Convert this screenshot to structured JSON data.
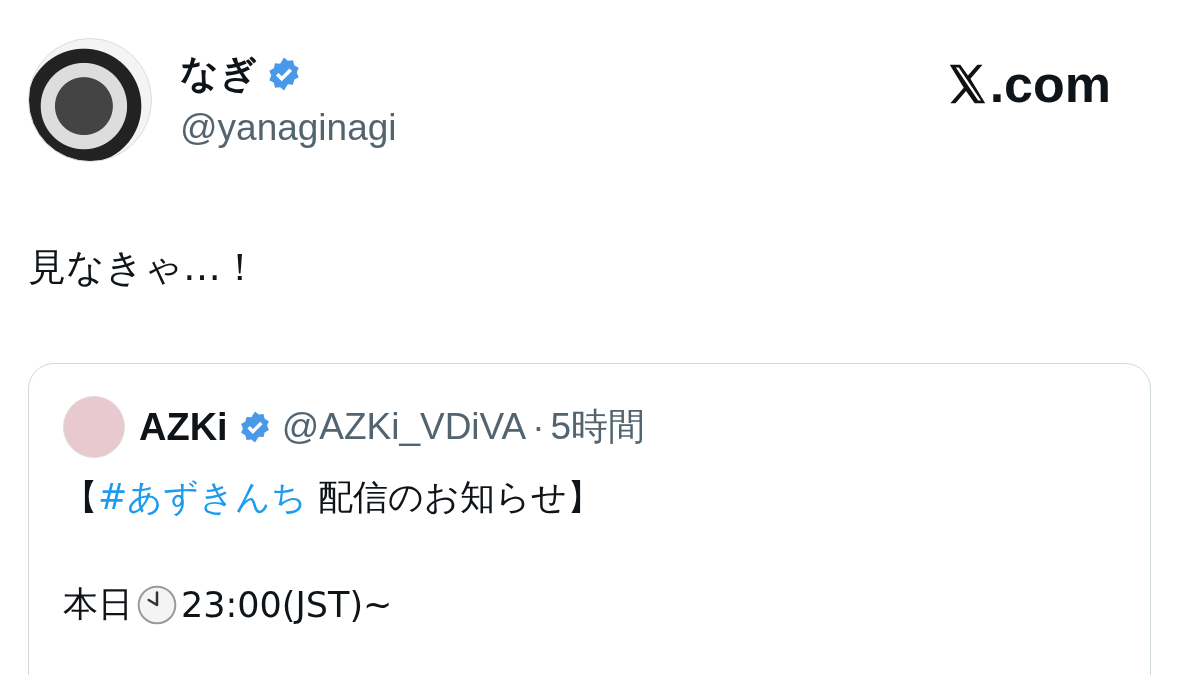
{
  "author": {
    "name": "なぎ",
    "verified": true,
    "handle": "@yanaginagi"
  },
  "site": {
    "domain": ".com"
  },
  "tweet": {
    "text": "見なきゃ…！"
  },
  "quote": {
    "author": {
      "name": "AZKi",
      "verified": true,
      "handle": "@AZKi_VDiVA",
      "separator": "·",
      "time": "5時間"
    },
    "lines": [
      {
        "kind": "title",
        "prefix": "【",
        "hashtag": "#あずきんち",
        "rest": " 配信のお知らせ】"
      },
      {
        "kind": "time",
        "before": "本日",
        "after": "23:00(JST)~"
      }
    ]
  }
}
